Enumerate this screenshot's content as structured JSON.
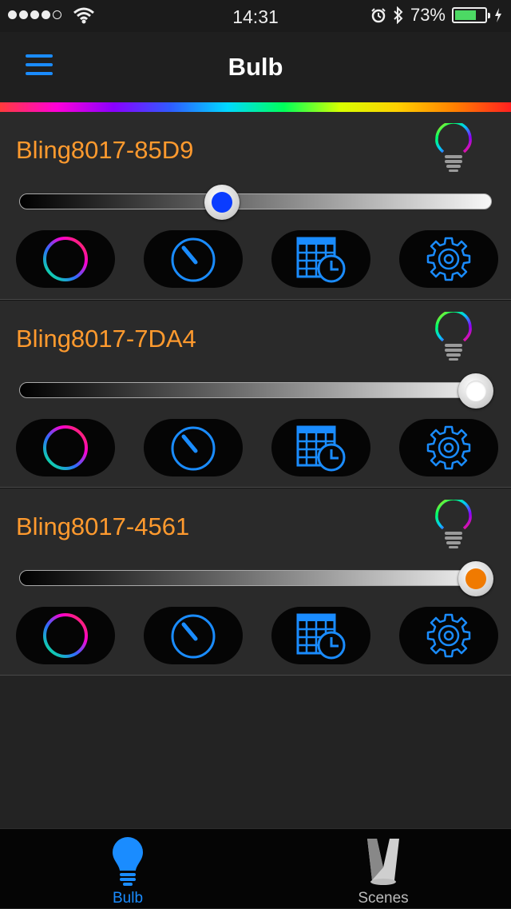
{
  "status_bar": {
    "time": "14:31",
    "battery": "73%",
    "battery_level": 0.73,
    "signal_bars": 4
  },
  "header": {
    "title": "Bulb"
  },
  "bulbs": [
    {
      "name": "Bling8017-85D9",
      "brightness": 0.42,
      "thumb_color": "#0a3cff"
    },
    {
      "name": "Bling8017-7DA4",
      "brightness": 1.0,
      "thumb_color": "#ffffff"
    },
    {
      "name": "Bling8017-4561",
      "brightness": 1.0,
      "thumb_color": "#f07a00"
    }
  ],
  "tabs": [
    {
      "label": "Bulb",
      "active": true
    },
    {
      "label": "Scenes",
      "active": false
    }
  ],
  "colors": {
    "accent": "#1a8cff",
    "bulb_name": "#ff9a2e"
  }
}
